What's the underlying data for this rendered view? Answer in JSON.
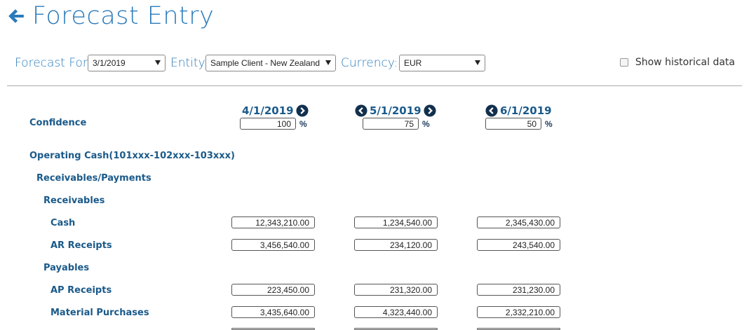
{
  "page": {
    "title": "Forecast Entry"
  },
  "filters": {
    "forecast_for_label": "Forecast For:",
    "forecast_for_value": "3/1/2019",
    "entity_label": "Entity:",
    "entity_value": "Sample Client - New Zealand",
    "currency_label": "Currency:",
    "currency_value": "EUR",
    "show_historical_label": "Show historical data",
    "show_historical_checked": false
  },
  "columns": [
    {
      "date": "4/1/2019",
      "confidence": "100",
      "prev_nav": false,
      "next_nav": true
    },
    {
      "date": "5/1/2019",
      "confidence": "75",
      "prev_nav": true,
      "next_nav": true
    },
    {
      "date": "6/1/2019",
      "confidence": "50",
      "prev_nav": true,
      "next_nav": false
    }
  ],
  "confidence": {
    "label": "Confidence",
    "suffix": "%"
  },
  "rows": [
    {
      "label": "Operating Cash(101xxx-102xxx-103xxx)",
      "level": 0,
      "values": []
    },
    {
      "label": "Receivables/Payments",
      "level": 1,
      "values": []
    },
    {
      "label": "Receivables",
      "level": 2,
      "values": []
    },
    {
      "label": "Cash",
      "level": 3,
      "values": [
        "12,343,210.00",
        "1,234,540.00",
        "2,345,430.00"
      ]
    },
    {
      "label": "AR Receipts",
      "level": 3,
      "values": [
        "3,456,540.00",
        "234,120.00",
        "243,540.00"
      ]
    },
    {
      "label": "Payables",
      "level": 2,
      "values": []
    },
    {
      "label": "AP Receipts",
      "level": 3,
      "values": [
        "223,450.00",
        "231,320.00",
        "231,230.00"
      ]
    },
    {
      "label": "Material Purchases",
      "level": 3,
      "values": [
        "3,435,640.00",
        "4,323,440.00",
        "2,332,210.00"
      ]
    },
    {
      "label": "",
      "level": 3,
      "values": [
        "",
        "",
        ""
      ]
    }
  ],
  "colors": {
    "title": "#2b7bba",
    "label": "#1a5a8a",
    "nav_icon": "#12304e"
  }
}
